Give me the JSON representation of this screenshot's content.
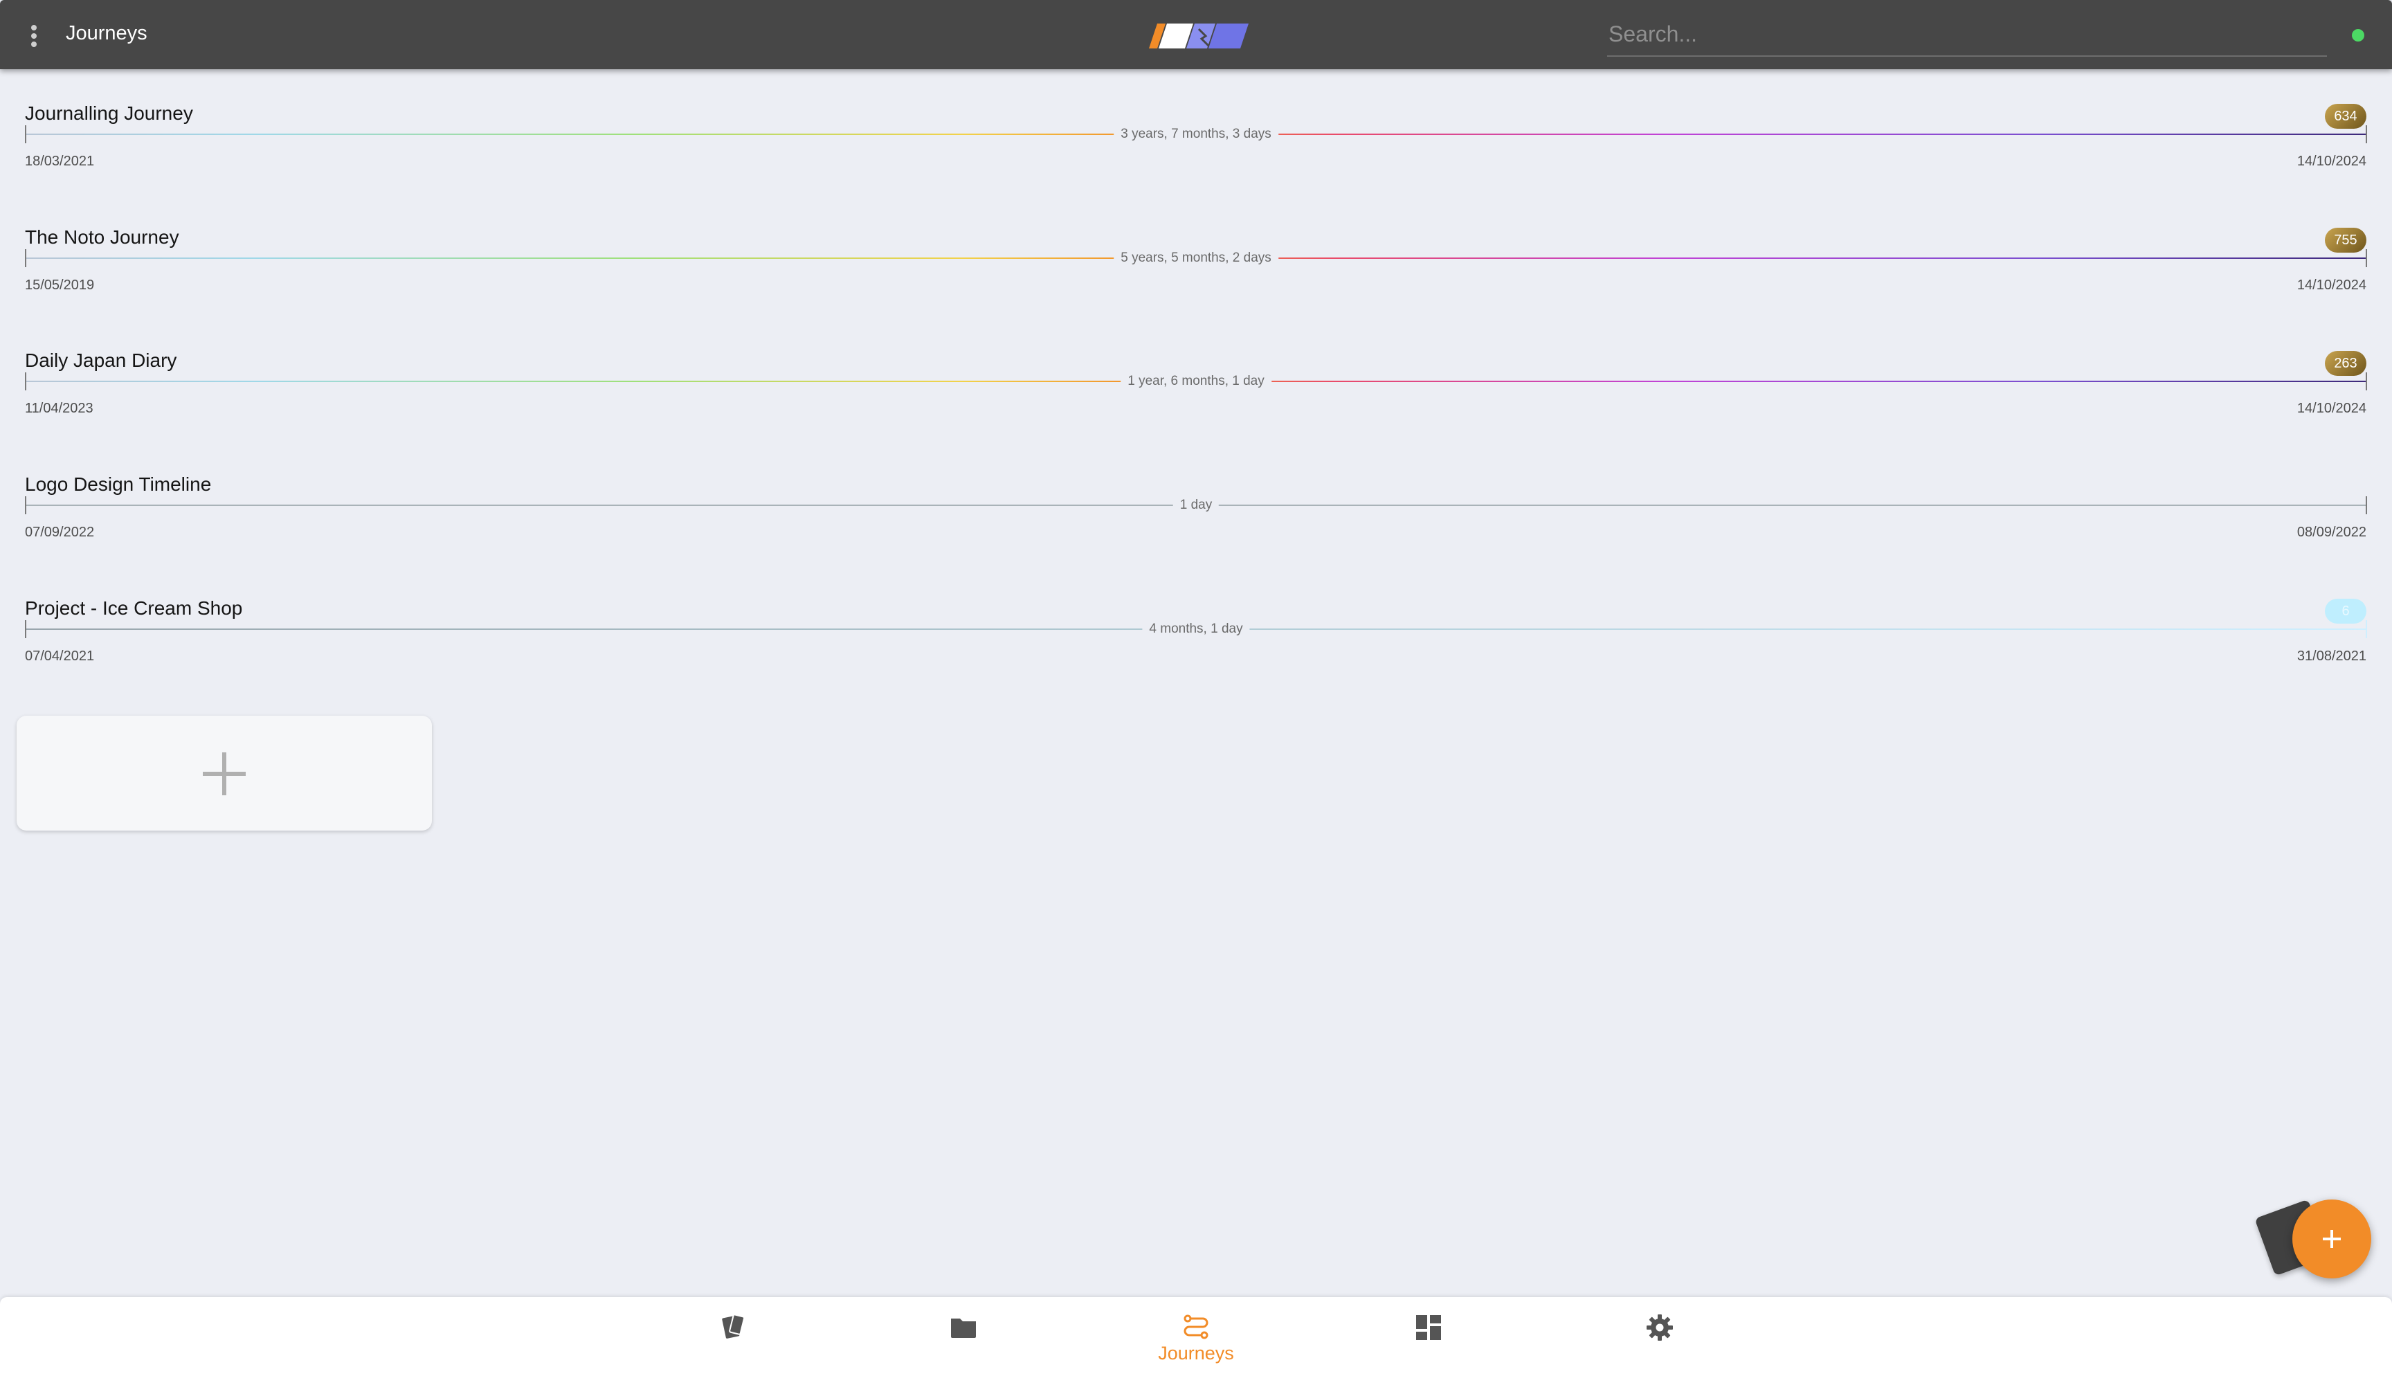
{
  "header": {
    "title": "Journeys",
    "search_placeholder": "Search...",
    "status_color": "#4cd964"
  },
  "journeys": [
    {
      "title": "Journalling Journey",
      "count": "634",
      "duration": "3 years, 7 months, 3 days",
      "start_date": "18/03/2021",
      "end_date": "14/10/2024"
    },
    {
      "title": "The Noto Journey",
      "count": "755",
      "duration": "5 years, 5 months, 2 days",
      "start_date": "15/05/2019",
      "end_date": "14/10/2024"
    },
    {
      "title": "Daily Japan Diary",
      "count": "263",
      "duration": "1 year, 6 months, 1 day",
      "start_date": "11/04/2023",
      "end_date": "14/10/2024"
    },
    {
      "title": "Logo Design Timeline",
      "count": "",
      "duration": "1 day",
      "start_date": "07/09/2022",
      "end_date": "08/09/2022"
    },
    {
      "title": "Project - Ice Cream Shop",
      "count": "6",
      "duration": "4 months, 1 day",
      "start_date": "07/04/2021",
      "end_date": "31/08/2021"
    }
  ],
  "icons": {
    "menu": "more-vert-icon",
    "add_card": "plus-icon",
    "fab": "plus-icon",
    "nav_cards": "cards-icon",
    "nav_folders": "folder-icon",
    "nav_journeys": "route-icon",
    "nav_dashboard": "dashboard-icon",
    "nav_settings": "gear-icon"
  },
  "nav": {
    "active_label": "Journeys"
  },
  "colors": {
    "accent": "#f28c28",
    "appbar": "#474747",
    "background": "#eceef4",
    "badge_gold": "#9a7a2e",
    "badge_light": "#bfeefe",
    "nav_icon": "#555555"
  }
}
